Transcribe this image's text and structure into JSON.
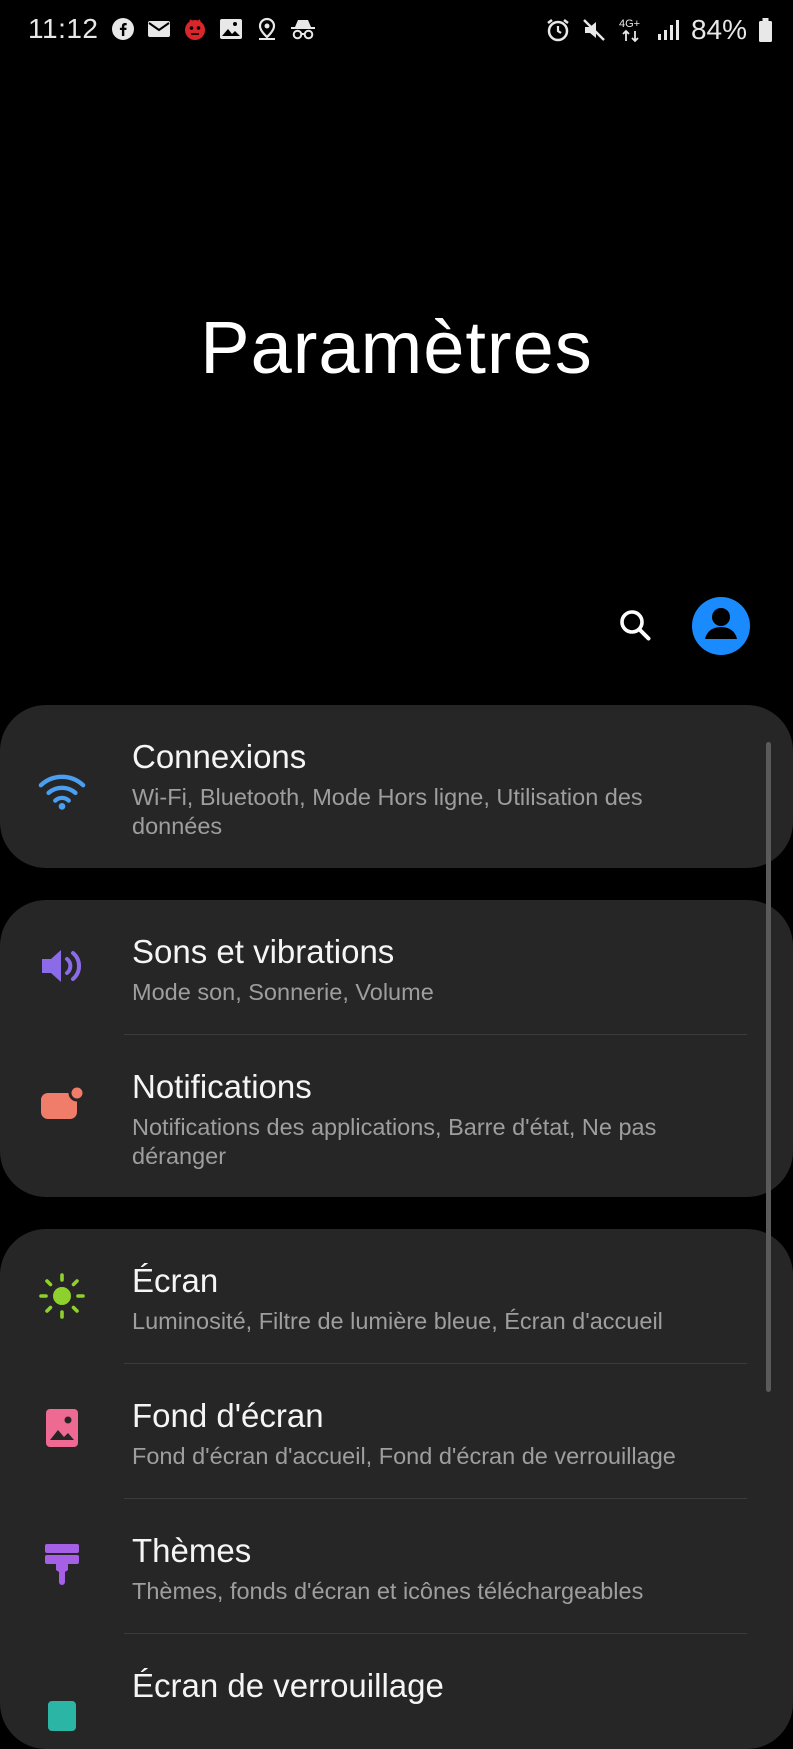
{
  "status_bar": {
    "time": "11:12",
    "left_icons": [
      "facebook-icon",
      "mail-icon",
      "bug-icon",
      "image-icon",
      "location-icon",
      "incognito-icon"
    ],
    "right_icons": [
      "alarm-icon",
      "mute-icon",
      "network-4g-icon",
      "signal-icon"
    ],
    "battery": "84%"
  },
  "header": {
    "title": "Paramètres"
  },
  "settings": {
    "connections": {
      "title": "Connexions",
      "subtitle": "Wi-Fi, Bluetooth, Mode Hors ligne, Utilisation des données",
      "icon": "wifi-icon",
      "color": "#4a9ff0"
    },
    "sounds": {
      "title": "Sons et vibrations",
      "subtitle": "Mode son, Sonnerie, Volume",
      "icon": "volume-icon",
      "color": "#8b6be8"
    },
    "notifications": {
      "title": "Notifications",
      "subtitle": "Notifications des applications, Barre d'état, Ne pas déranger",
      "icon": "notification-icon",
      "color": "#ef7d6a"
    },
    "display": {
      "title": "Écran",
      "subtitle": "Luminosité, Filtre de lumière bleue, Écran d'accueil",
      "icon": "brightness-icon",
      "color": "#8fd12c"
    },
    "wallpaper": {
      "title": "Fond d'écran",
      "subtitle": "Fond d'écran d'accueil, Fond d'écran de verrouillage",
      "icon": "wallpaper-icon",
      "color": "#ee6a93"
    },
    "themes": {
      "title": "Thèmes",
      "subtitle": "Thèmes, fonds d'écran et icônes téléchargeables",
      "icon": "theme-brush-icon",
      "color": "#a560e6"
    },
    "lockscreen": {
      "title": "Écran de verrouillage",
      "icon": "lock-screen-icon",
      "color": "#2bb5a4"
    }
  }
}
